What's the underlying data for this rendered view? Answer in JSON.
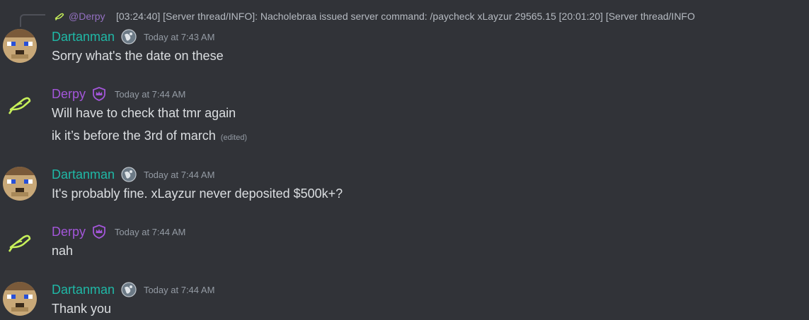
{
  "reply": {
    "author": "@Derpy",
    "text": "[03:24:40] [Server thread/INFO]: Nacholebraa issued server command: /paycheck xLayzur 29565.15 [20:01:20] [Server thread/INFO"
  },
  "messages": [
    {
      "author": "Dartanman",
      "timestamp": "Today at 7:43 AM",
      "lines": [
        "Sorry what's the date on these"
      ]
    },
    {
      "author": "Derpy",
      "timestamp": "Today at 7:44 AM",
      "lines": [
        "Will have to check that tmr again",
        "ik it’s before the 3rd of march"
      ],
      "edited": "(edited)"
    },
    {
      "author": "Dartanman",
      "timestamp": "Today at 7:44 AM",
      "lines": [
        "It's probably fine. xLayzur never deposited $500k+?"
      ]
    },
    {
      "author": "Derpy",
      "timestamp": "Today at 7:44 AM",
      "lines": [
        "nah"
      ]
    },
    {
      "author": "Dartanman",
      "timestamp": "Today at 7:44 AM",
      "lines": [
        "Thank you"
      ]
    }
  ],
  "colors": {
    "background": "#313338",
    "dartanman_name": "#1fb8a6",
    "derpy_name": "#a356d9",
    "text": "#dbdee1",
    "muted": "#949ba4"
  },
  "icons": {
    "dartanman_avatar": "pixel-face-avatar",
    "derpy_avatar": "bird-icon",
    "dartanman_badge": "globe-badge-icon",
    "derpy_badge": "crown-shield-icon"
  }
}
